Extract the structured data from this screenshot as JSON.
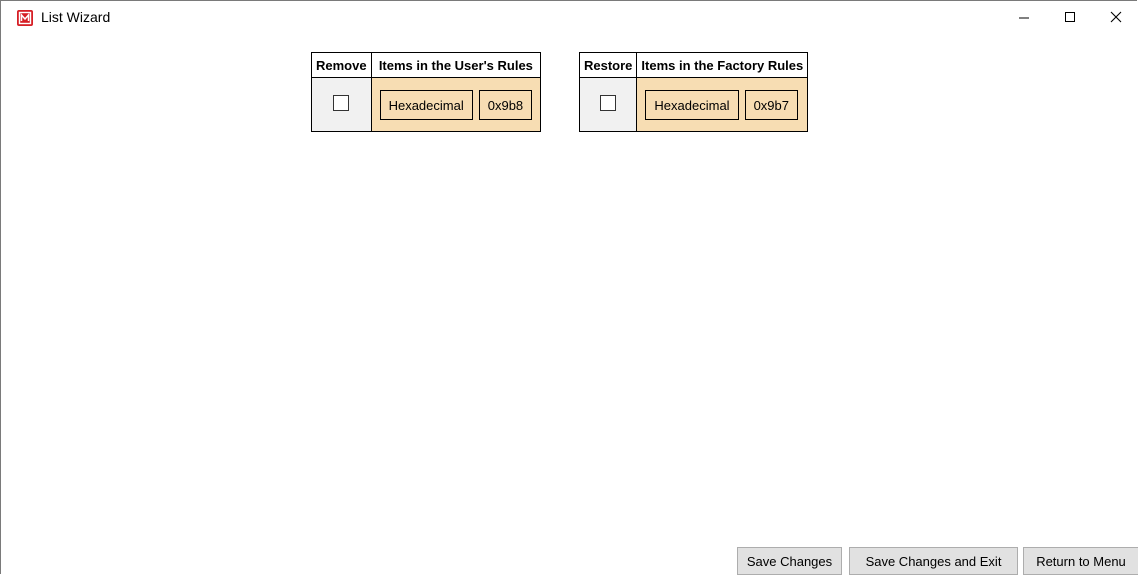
{
  "window": {
    "title": "List Wizard",
    "icon": "app-logo-icon",
    "controls": [
      "minimize-icon",
      "maximize-icon",
      "close-icon"
    ]
  },
  "user_rules_table": {
    "headers": {
      "remove": "Remove",
      "items": "Items in the User's Rules"
    },
    "rows": [
      {
        "checked": false,
        "items": [
          "Hexadecimal",
          "0x9b8"
        ]
      }
    ]
  },
  "factory_rules_table": {
    "headers": {
      "restore": "Restore",
      "items": "Items in the Factory Rules"
    },
    "rows": [
      {
        "checked": false,
        "items": [
          "Hexadecimal",
          "0x9b7"
        ]
      }
    ]
  },
  "buttons": {
    "save": "Save Changes",
    "save_exit": "Save Changes and Exit",
    "return_menu": "Return to Menu"
  },
  "colors": {
    "item_cell_bg": "#f7ddb3",
    "checkbox_cell_bg": "#f1f1f1",
    "button_bg": "#e1e1e1",
    "app_icon": "#d61f26"
  }
}
